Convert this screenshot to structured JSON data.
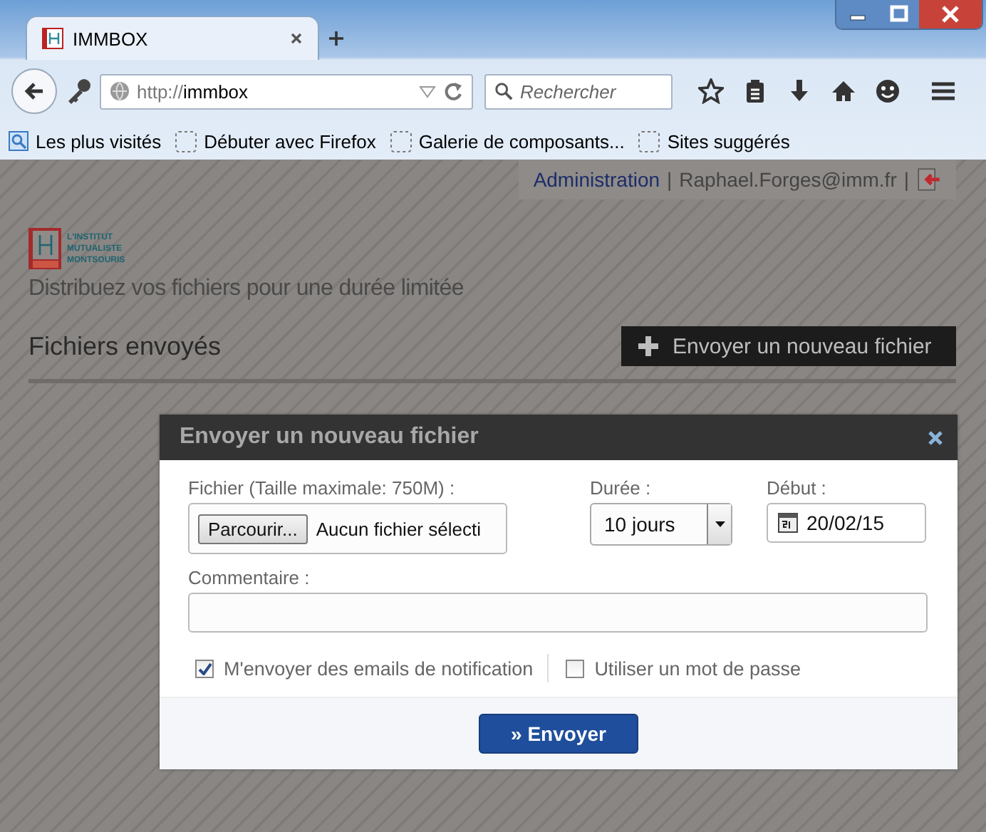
{
  "browser": {
    "tab": {
      "title": "IMMBOX",
      "selected": true
    },
    "url": {
      "scheme": "http://",
      "host": "immbox"
    },
    "search": {
      "placeholder": "Rechercher"
    },
    "bookmarks": [
      "Les plus visités",
      "Débuter avec Firefox",
      "Galerie de composants...",
      "Sites suggérés"
    ]
  },
  "site": {
    "user_bar": [
      {
        "kind": "link",
        "text": "Administration"
      },
      {
        "kind": "sep",
        "text": "|"
      },
      {
        "kind": "text",
        "text": "Raphael.Forges@imm.fr"
      },
      {
        "kind": "sep",
        "text": "|"
      }
    ],
    "logo_lines": [
      "L'INSTITUT",
      "MUTUALISTE",
      "MONTSOURIS"
    ],
    "tagline": "Distribuez vos fichiers pour une durée limitée",
    "section_title": "Fichiers envoyés",
    "new_file_button": "Envoyer un nouveau fichier"
  },
  "dialog": {
    "title": "Envoyer un nouveau fichier",
    "file": {
      "label": "Fichier (Taille maximale: 750M) :",
      "browse": "Parcourir...",
      "status": "Aucun fichier sélecti"
    },
    "duration": {
      "label": "Durée :",
      "value": "10 jours"
    },
    "start": {
      "label": "Début :",
      "value": "20/02/15"
    },
    "comment": {
      "label": "Commentaire :"
    },
    "options": [
      {
        "label": "M'envoyer des emails de notification",
        "checked": true
      },
      {
        "label": "Utiliser un mot de passe",
        "checked": false
      }
    ],
    "submit": "» Envoyer"
  }
}
